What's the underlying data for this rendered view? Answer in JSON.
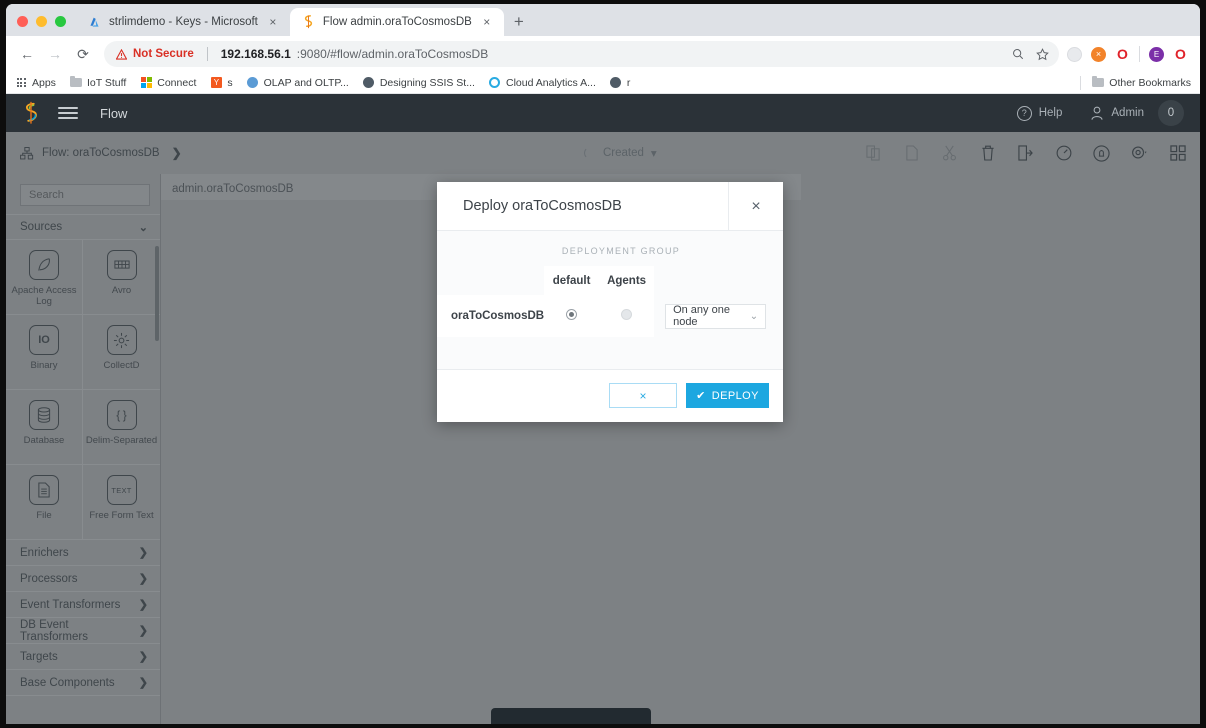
{
  "browser": {
    "tabs": [
      {
        "title": "strlimdemo - Keys - Microsoft ",
        "favicon": "azure-icon",
        "active": false,
        "close_label": "×"
      },
      {
        "title": "Flow admin.oraToCosmosDB",
        "favicon": "striim-icon",
        "active": true,
        "close_label": "×"
      }
    ],
    "new_tab_label": "+",
    "nav": {
      "back": "←",
      "forward": "→",
      "reload": "⟳"
    },
    "omnibox": {
      "warning_icon": "warning-triangle-icon",
      "security_label": "Not Secure",
      "url_host": "192.168.56.1",
      "url_rest": ":9080/#flow/admin.oraToCosmosDB",
      "zoom_icon": "zoom-icon",
      "bookmark_icon": "star-icon"
    },
    "extensions": [
      {
        "name": "grey-extension-icon",
        "label": ""
      },
      {
        "name": "orange-x-extension-icon",
        "label": "×"
      },
      {
        "name": "opera-extension-icon",
        "label": "O"
      },
      {
        "name": "profile-avatar",
        "label": "E"
      },
      {
        "name": "opera-extension-icon-2",
        "label": "O"
      }
    ],
    "bookmarks": [
      {
        "label": "Apps",
        "icon": "apps-grid-icon"
      },
      {
        "label": "IoT Stuff",
        "icon": "folder-icon"
      },
      {
        "label": "Connect",
        "icon": "microsoft-icon"
      },
      {
        "label": "s",
        "icon": "yahoo-icon"
      },
      {
        "label": "OLAP and OLTP...",
        "icon": "globe-blue-icon"
      },
      {
        "label": "Designing SSIS St...",
        "icon": "globe-dark-icon"
      },
      {
        "label": "Cloud Analytics A...",
        "icon": "globe-cyan-icon"
      },
      {
        "label": "r",
        "icon": "globe-dark-icon"
      }
    ],
    "other_bookmarks": {
      "label": "Other Bookmarks",
      "icon": "folder-icon"
    }
  },
  "app": {
    "logo": "striim-logo",
    "menu_icon": "hamburger-menu-icon",
    "title": "Flow",
    "help": {
      "label": "Help",
      "icon": "question-circle-icon"
    },
    "user": {
      "label": "Admin",
      "icon": "user-icon"
    },
    "badge_count": "0"
  },
  "subbar": {
    "breadcrumb_icon": "flow-node-icon",
    "breadcrumb_label": "Flow: oraToCosmosDB",
    "breadcrumb_chevron": "❯",
    "status_label": "Created",
    "status_caret": "▾",
    "tools": [
      {
        "name": "copy-to-icon",
        "dim": true
      },
      {
        "name": "copy-icon",
        "dim": true
      },
      {
        "name": "cut-icon",
        "dim": true
      },
      {
        "name": "delete-icon",
        "dim": false
      },
      {
        "name": "export-icon",
        "dim": false
      },
      {
        "name": "monitor-gauge-icon",
        "dim": false
      },
      {
        "name": "alerts-bell-icon",
        "dim": false
      },
      {
        "name": "settings-gear-icon",
        "dim": false
      },
      {
        "name": "grid-view-icon",
        "dim": false
      }
    ]
  },
  "sidebar": {
    "search_placeholder": "Search",
    "sources": {
      "label": "Sources",
      "chevron": "⌄",
      "items": [
        {
          "label": "Apache Access Log",
          "icon": "feather-icon",
          "glyph": "✒"
        },
        {
          "label": "Avro",
          "icon": "avro-icon",
          "glyph": "▤"
        },
        {
          "label": "Binary",
          "icon": "binary-icon",
          "glyph": "IO"
        },
        {
          "label": "CollectD",
          "icon": "collectd-icon",
          "glyph": "☀"
        },
        {
          "label": "Database",
          "icon": "database-icon",
          "glyph": "⛃"
        },
        {
          "label": "Delim-Separated",
          "icon": "braces-icon",
          "glyph": "{ }"
        },
        {
          "label": "File",
          "icon": "file-icon",
          "glyph": "☰"
        },
        {
          "label": "Free Form Text",
          "icon": "text-icon",
          "glyph": "TEXT"
        }
      ]
    },
    "sections": [
      {
        "label": "Enrichers",
        "chevron": "❯"
      },
      {
        "label": "Processors",
        "chevron": "❯"
      },
      {
        "label": "Event Transformers",
        "chevron": "❯"
      },
      {
        "label": "DB Event Transformers",
        "chevron": "❯"
      },
      {
        "label": "Targets",
        "chevron": "❯"
      },
      {
        "label": "Base Components",
        "chevron": "❯"
      }
    ]
  },
  "canvas": {
    "label": "admin.oraToCosmosDB"
  },
  "modal": {
    "title": "Deploy oraToCosmosDB",
    "close_label": "×",
    "group_header": "DEPLOYMENT GROUP",
    "columns": [
      "default",
      "Agents"
    ],
    "rows": [
      {
        "name": "oraToCosmosDB",
        "default_selected": true,
        "agents_selected": false,
        "node_option": "On any one node",
        "node_caret": "⌄"
      }
    ],
    "cancel_label": "×",
    "deploy_label": "DEPLOY",
    "deploy_check": "✔",
    "accent_color": "#1ca7e2"
  }
}
